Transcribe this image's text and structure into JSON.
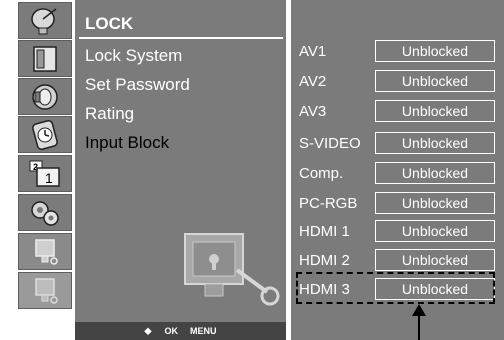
{
  "menu": {
    "title": "LOCK",
    "items": [
      {
        "label": "Lock System"
      },
      {
        "label": "Set Password"
      },
      {
        "label": "Rating"
      },
      {
        "label": "Input Block"
      }
    ],
    "selected_item": "Input Block"
  },
  "icons": [
    "satellite-icon",
    "picture-icon",
    "audio-icon",
    "clock-icon",
    "pip-icon",
    "option-gears-icon",
    "lock-icon"
  ],
  "footer": {
    "nav_symbol": "⬥",
    "ok_label": "OK",
    "menu_label": "MENU"
  },
  "inputs": [
    {
      "label": "AV1",
      "status": "Unblocked"
    },
    {
      "label": "AV2",
      "status": "Unblocked"
    },
    {
      "label": "AV3",
      "status": "Unblocked"
    },
    {
      "label": "S-VIDEO",
      "status": "Unblocked"
    },
    {
      "label": "Comp.",
      "status": "Unblocked"
    },
    {
      "label": "PC-RGB",
      "status": "Unblocked"
    },
    {
      "label": "HDMI 1",
      "status": "Unblocked"
    },
    {
      "label": "HDMI 2",
      "status": "Unblocked"
    },
    {
      "label": "HDMI 3",
      "status": "Unblocked"
    }
  ],
  "highlighted_input": "HDMI 3",
  "colors": {
    "panel": "#7b7b7b",
    "text": "#ffffff",
    "selected_text": "#000000"
  }
}
